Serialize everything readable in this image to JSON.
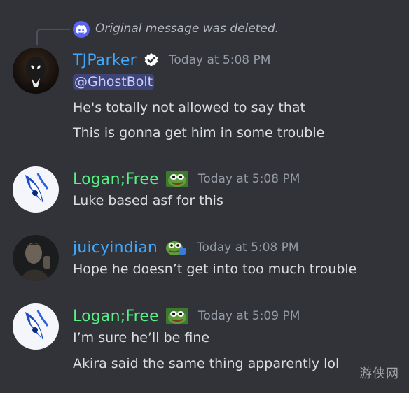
{
  "colors": {
    "background": "#313338",
    "tjparker": "#3fa9ff",
    "logan": "#57f287",
    "juicyindian": "#3fa9ff",
    "mention_bg": "#5865f2"
  },
  "reply": {
    "icon": "discord-icon",
    "text": "Original message was deleted."
  },
  "messages": [
    {
      "username": "TJParker",
      "badge": "verified-check-icon",
      "timestamp": "Today at 5:08 PM",
      "mention": "@GhostBolt",
      "lines": [
        "He's totally not allowed to say that",
        "This is gonna get him in some trouble"
      ]
    },
    {
      "username": "Logan;Free",
      "badge": "pepe-frog-icon",
      "timestamp": "Today at 5:08 PM",
      "lines": [
        "Luke based asf for this"
      ]
    },
    {
      "username": "juicyindian",
      "badge": "pepe-frog-icon",
      "timestamp": "Today at 5:08 PM",
      "lines": [
        "Hope he doesn’t get into too much trouble"
      ]
    },
    {
      "username": "Logan;Free",
      "badge": "pepe-frog-icon",
      "timestamp": "Today at 5:09 PM",
      "lines": [
        "I’m sure he’ll be fine",
        "Akira said the same thing apparently lol"
      ]
    }
  ],
  "watermark": "游侠网"
}
